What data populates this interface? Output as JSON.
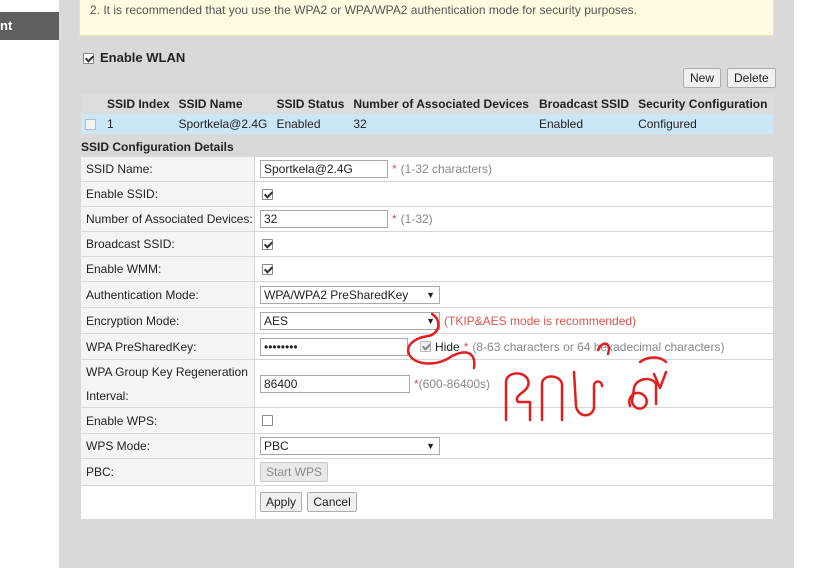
{
  "nav": {
    "left_tab_label": "nt"
  },
  "note": {
    "text": "2. It is recommended that you use the WPA2 or WPA/WPA2 authentication mode for security purposes."
  },
  "enable_wlan": {
    "label": "Enable WLAN",
    "checked": true
  },
  "toolbar": {
    "new_label": "New",
    "delete_label": "Delete"
  },
  "ssid_table": {
    "headers": [
      "SSID Index",
      "SSID Name",
      "SSID Status",
      "Number of Associated Devices",
      "Broadcast SSID",
      "Security Configuration"
    ],
    "rows": [
      {
        "index": "1",
        "name": "Sportkela@2.4G",
        "status": "Enabled",
        "devices": "32",
        "broadcast": "Enabled",
        "security": "Configured"
      }
    ]
  },
  "config": {
    "title": "SSID Configuration Details",
    "ssid_name": {
      "label": "SSID Name:",
      "value": "Sportkela@2.4G",
      "hint": "(1-32 characters)"
    },
    "enable_ssid": {
      "label": "Enable SSID:",
      "checked": true
    },
    "assoc_devices": {
      "label": "Number of Associated Devices:",
      "value": "32",
      "hint": "(1-32)"
    },
    "broadcast_ssid": {
      "label": "Broadcast SSID:",
      "checked": true
    },
    "enable_wmm": {
      "label": "Enable WMM:",
      "checked": true
    },
    "auth_mode": {
      "label": "Authentication Mode:",
      "value": "WPA/WPA2 PreSharedKey"
    },
    "encryption_mode": {
      "label": "Encryption Mode:",
      "value": "AES",
      "note": "(TKIP&AES mode is recommended)"
    },
    "psk": {
      "label": "WPA PreSharedKey:",
      "value": "••••••••",
      "hide_label": "Hide",
      "hide_checked": true,
      "hint": "(8-63 characters or 64 hexadecimal characters)"
    },
    "group_key": {
      "label_line1": "WPA Group Key Regeneration",
      "label_line2": "Interval:",
      "value": "86400",
      "hint": "(600-86400s)"
    },
    "enable_wps": {
      "label": "Enable WPS:",
      "checked": false
    },
    "wps_mode": {
      "label": "WPS Mode:",
      "value": "PBC"
    },
    "pbc": {
      "label": "PBC:",
      "button_label": "Start WPS"
    },
    "apply_label": "Apply",
    "cancel_label": "Cancel",
    "required_mark": "*"
  },
  "colors": {
    "accent_red": "#d9534f",
    "row_selected": "#cbe6f7",
    "note_bg": "#fffbe0",
    "annotation_red": "#e02020"
  }
}
